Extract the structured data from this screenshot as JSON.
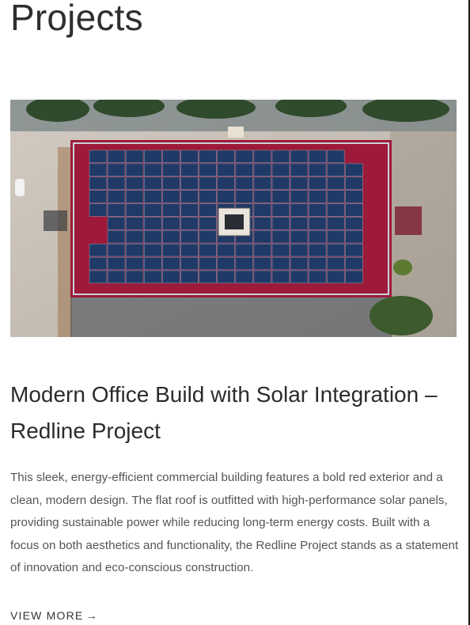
{
  "page": {
    "title": "Projects"
  },
  "project": {
    "image_alt": "Aerial view of red-roofed office building with rooftop solar panels",
    "title": "Modern Office Build with Solar Integration – Redline Project",
    "description": "This sleek, energy-efficient commercial building features a bold red exterior and a clean, modern design. The flat roof is outfitted with high-performance solar panels, providing sustainable power while reducing long-term energy costs. Built with a focus on both aesthetics and functionality, the Redline Project stands as a statement of innovation and eco-conscious construction.",
    "link_label": "VIEW MORE",
    "link_icon": "arrow-right-icon",
    "link_glyph": "→"
  },
  "colors": {
    "roof_red": "#9e1a3a",
    "panel_blue": "#1f3a66",
    "pavement": "#c9c2b8"
  }
}
